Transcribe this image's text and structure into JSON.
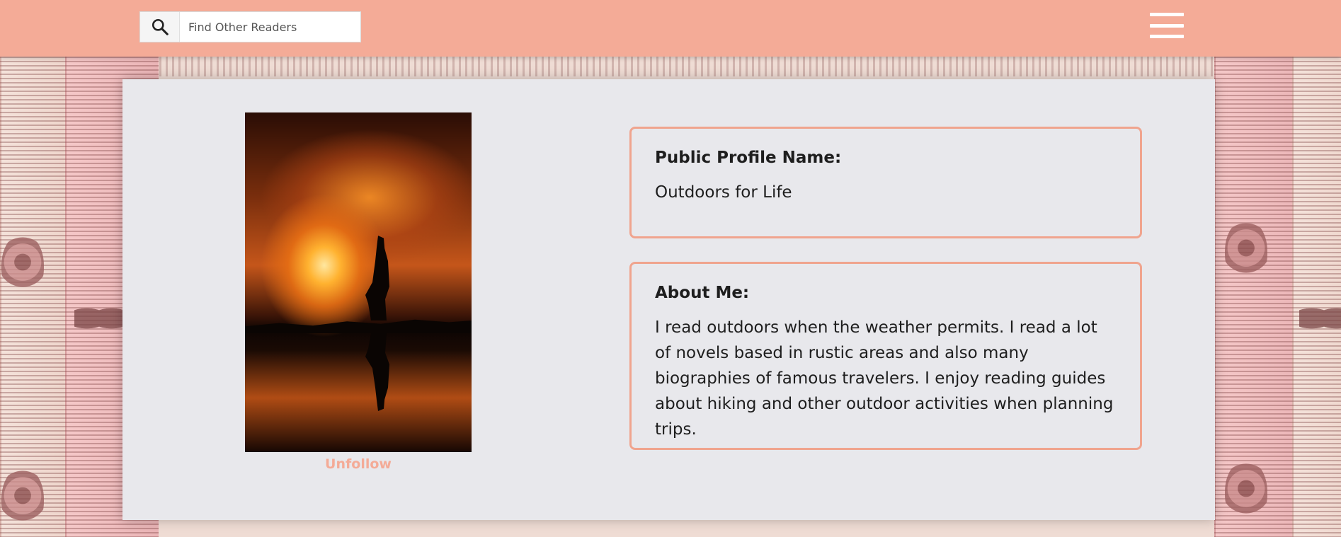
{
  "header": {
    "search": {
      "placeholder": "Find Other Readers"
    },
    "menu_icon": "hamburger-menu-icon"
  },
  "profile": {
    "photo_icon": "profile-photo-silhouette-sunset",
    "follow_label": "Unfollow",
    "name_label": "Public Profile Name:",
    "name_value": "Outdoors for Life",
    "about_label": "About Me:",
    "about_value": "I read outdoors when the weather permits. I read a lot of novels based in rustic areas and also many biographies of famous travelers. I enjoy reading guides about hiking and other outdoor activities when planning trips."
  },
  "colors": {
    "header_bg": "#f4ab97",
    "accent": "#f0a48e",
    "card_bg": "#e8e8ec",
    "text": "#1e1e1e"
  }
}
